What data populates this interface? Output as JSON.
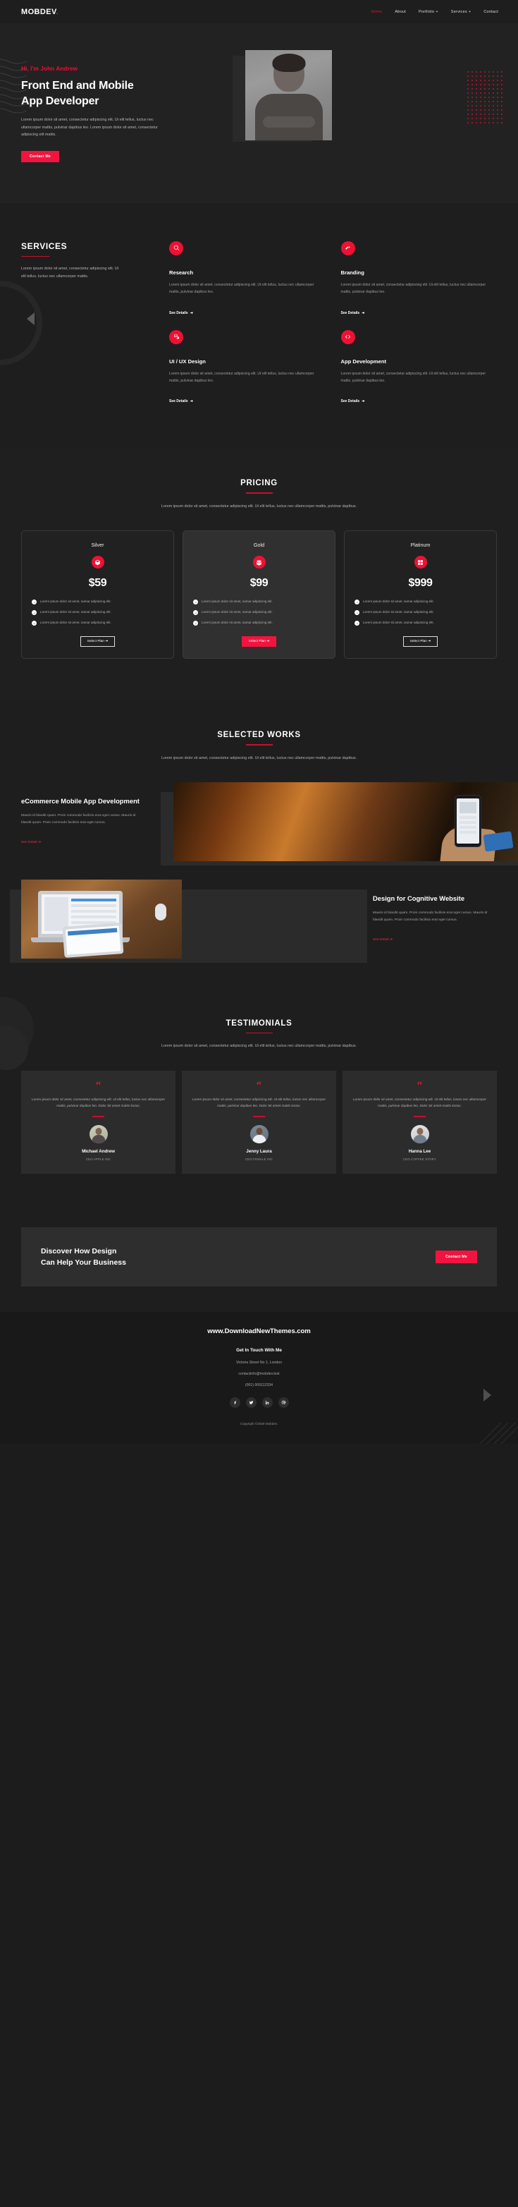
{
  "brand": {
    "name": "MOBDEV",
    "dot": "."
  },
  "nav": [
    {
      "label": "Home",
      "active": true,
      "plus": false
    },
    {
      "label": "About",
      "active": false,
      "plus": false
    },
    {
      "label": "Portfolio",
      "active": false,
      "plus": true
    },
    {
      "label": "Services",
      "active": false,
      "plus": true
    },
    {
      "label": "Contact",
      "active": false,
      "plus": false
    }
  ],
  "hero": {
    "kicker": "Hi, I'm John Andrew",
    "title_line1": "Front End and Mobile",
    "title_line2": "App Developer",
    "desc": "Lorem ipsum dolor sit amet, consectetur adipiscing elit. Ut elit tellus, luctus nec ullamcorper mattis, pulvinar dapibus leo. Lorem ipsum dolor sit amet, consectetur adipiscing elit mattis.",
    "cta": "Contact Me"
  },
  "services": {
    "title": "SERVICES",
    "intro": "Lorem ipsum dolor sit amet, consectetur adipiscing elit. Ut elit tellus, luctus nec ullamcorper mattis.",
    "see_details": "See Details",
    "arrow": "➜",
    "items": [
      {
        "icon": "search-icon",
        "title": "Research",
        "desc": "Lorem ipsum dolor sit amet, consectetur adipiscing elit. Ut elit tellus, luctus nec ullamcorper mattis, pulvinar dapibus leo."
      },
      {
        "icon": "magic-wand-icon",
        "title": "Branding",
        "desc": "Lorem ipsum dolor sit amet, consectetur adipiscing elit. Ut elit tellus, luctus nec ullamcorper mattis, pulvinar dapibus leo."
      },
      {
        "icon": "layers-icon",
        "title": "UI / UX Design",
        "desc": "Lorem ipsum dolor sit amet, consectetur adipiscing elit. Ut elit tellus, luctus nec ullamcorper mattis, pulvinar dapibus leo."
      },
      {
        "icon": "code-icon",
        "title": "App Development",
        "desc": "Lorem ipsum dolor sit amet, consectetur adipiscing elit. Ut elit tellus, luctus nec ullamcorper mattis, pulvinar dapibus leo."
      }
    ]
  },
  "pricing": {
    "title": "PRICING",
    "subtitle": "Lorem ipsum dolor sit amet, consectetur adipiscing elit. Ut elit tellus, luctus nec ullamcorper mattis, pulvinar dapibus.",
    "feature_text": "Lorem ipsum dolor sit amet, samar adipiscing elit.",
    "button": "Select Plan",
    "arrow": "➜",
    "plans": [
      {
        "name": "Silver",
        "price": "$59",
        "icon": "box-icon",
        "featured": false
      },
      {
        "name": "Gold",
        "price": "$99",
        "icon": "open-box-icon",
        "featured": true
      },
      {
        "name": "Platinum",
        "price": "$999",
        "icon": "boxes-icon",
        "featured": false
      }
    ]
  },
  "works": {
    "title": "SELECTED WORKS",
    "subtitle": "Lorem ipsum dolor sit amet, consectetur adipiscing elit. Ut elit tellus, luctus nec ullamcorper mattis, pulvinar dapibus.",
    "see_detail": "See Detail",
    "arrow": "➜",
    "items": [
      {
        "title": "eCommerce Mobile App Development",
        "desc": "Mauris id blandit quam. Proin commodo facilisis erat eget cursus. Mauris id blandit quam. Proin commodo facilisis erat eget cursus."
      },
      {
        "title": "Design for Cognitive Website",
        "desc": "Mauris id blandit quam. Proin commodo facilisis erat eget cursus. Mauris id blandit quam. Proin commodo facilisis erat eget cursus."
      }
    ]
  },
  "testimonials": {
    "title": "TESTIMONIALS",
    "subtitle": "Lorem ipsum dolor sit amet, consectetur adipiscing elit. Ut elit tellus, luctus nec ullamcorper mattis, pulvinar dapibus.",
    "quote_mark": "“",
    "items": [
      {
        "text": "Lorem ipsum dolor sit amet, consectetur adipiscing elit. Ut elit tellus, luctus nec ullamcorper mattis, pulvinar dapibus leo. Dolor Sit amiet mattis luctus.",
        "name": "Michael Andrew",
        "role": "CEO APPLE INC"
      },
      {
        "text": "Lorem ipsum dolor sit amet, consectetur adipiscing elit. Ut elit tellus, luctus nec ullamcorper mattis, pulvinar dapibus leo. Dolor Sit amiet mattis luctus.",
        "name": "Jenny Laura",
        "role": "CEO FEMALE INC"
      },
      {
        "text": "Lorem ipsum dolor sit amet, consectetur adipiscing elit. Ut elit tellus, luctus nec ullamcorper mattis, pulvinar dapibus leo. Dolor Sit amiet mattis luctus.",
        "name": "Hanna Lee",
        "role": "CEO COFFEE STORY"
      }
    ]
  },
  "cta": {
    "line1": "Discover How Design",
    "line2": "Can Help Your Business",
    "button": "Contact Me"
  },
  "footer": {
    "site": "www.DownloadNewThemes.com",
    "heading": "Get In Touch With Me",
    "address": "Victoria Street No 1, London",
    "email": "contactinfo@mobdev.test",
    "phone": "(001) 009112334",
    "socials": [
      "facebook-icon",
      "twitter-icon",
      "linkedin-icon",
      "dribbble-icon"
    ],
    "copyright": "Copyright ©2020 Mobdev."
  },
  "colors": {
    "accent": "#ee1133",
    "accent_bright": "#f2143e",
    "bg": "#1e1e1e",
    "panel": "#2c2c2c"
  }
}
